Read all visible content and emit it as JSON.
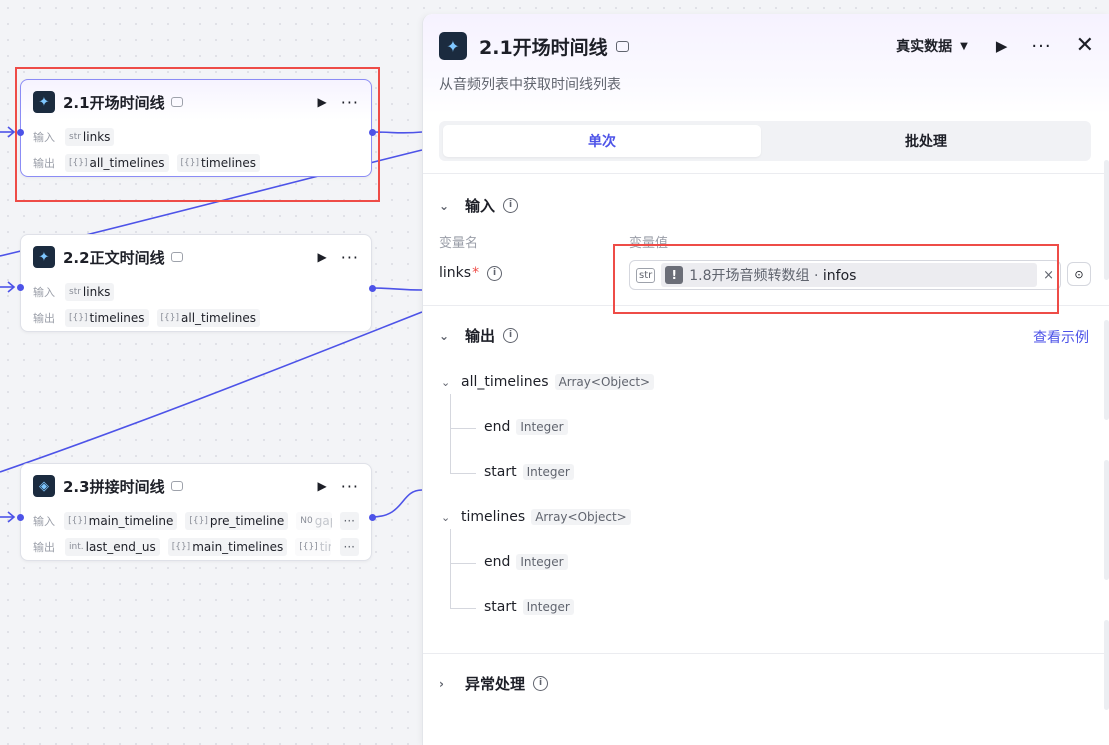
{
  "nodes": [
    {
      "title": "2.1开场时间线",
      "input_label": "输入",
      "output_label": "输出",
      "inputs": [
        {
          "type": "str",
          "name": "links"
        }
      ],
      "outputs": [
        {
          "type": "[{}]",
          "name": "all_timelines"
        },
        {
          "type": "[{}]",
          "name": "timelines"
        }
      ]
    },
    {
      "title": "2.2正文时间线",
      "input_label": "输入",
      "output_label": "输出",
      "inputs": [
        {
          "type": "str",
          "name": "links"
        }
      ],
      "outputs": [
        {
          "type": "[{}]",
          "name": "timelines"
        },
        {
          "type": "[{}]",
          "name": "all_timelines"
        }
      ]
    },
    {
      "title": "2.3拼接时间线",
      "input_label": "输入",
      "output_label": "输出",
      "inputs": [
        {
          "type": "[{}]",
          "name": "main_timeline"
        },
        {
          "type": "[{}]",
          "name": "pre_timeline"
        },
        {
          "type": "N0",
          "name": "gap"
        }
      ],
      "outputs": [
        {
          "type": "int.",
          "name": "last_end_us"
        },
        {
          "type": "[{}]",
          "name": "main_timelines"
        },
        {
          "type": "[{}]",
          "name": "tim"
        }
      ],
      "more": "···"
    }
  ],
  "panel": {
    "title": "2.1开场时间线",
    "description": "从音频列表中获取时间线列表",
    "mode": "真实数据",
    "tabs": {
      "single": "单次",
      "batch": "批处理"
    },
    "input_section": {
      "title": "输入",
      "col_name": "变量名",
      "col_value": "变量值",
      "var_name": "links",
      "var_type": "str",
      "ref_source": "1.8开场音频转数组",
      "ref_sep": " · ",
      "ref_field": "infos"
    },
    "output_section": {
      "title": "输出",
      "example_link": "查看示例",
      "fields": [
        {
          "name": "all_timelines",
          "type": "Array<Object>",
          "children": [
            {
              "name": "end",
              "type": "Integer"
            },
            {
              "name": "start",
              "type": "Integer"
            }
          ]
        },
        {
          "name": "timelines",
          "type": "Array<Object>",
          "children": [
            {
              "name": "end",
              "type": "Integer"
            },
            {
              "name": "start",
              "type": "Integer"
            }
          ]
        }
      ]
    },
    "error_section": {
      "title": "异常处理"
    }
  },
  "colors": {
    "accent": "#4d53e8",
    "highlight": "#ee4c47"
  },
  "icons": {
    "run": "▶",
    "more": "···",
    "close": "✕",
    "caret": "▼",
    "info": "i",
    "chevron_down": "⌄",
    "chevron_right": "›"
  }
}
